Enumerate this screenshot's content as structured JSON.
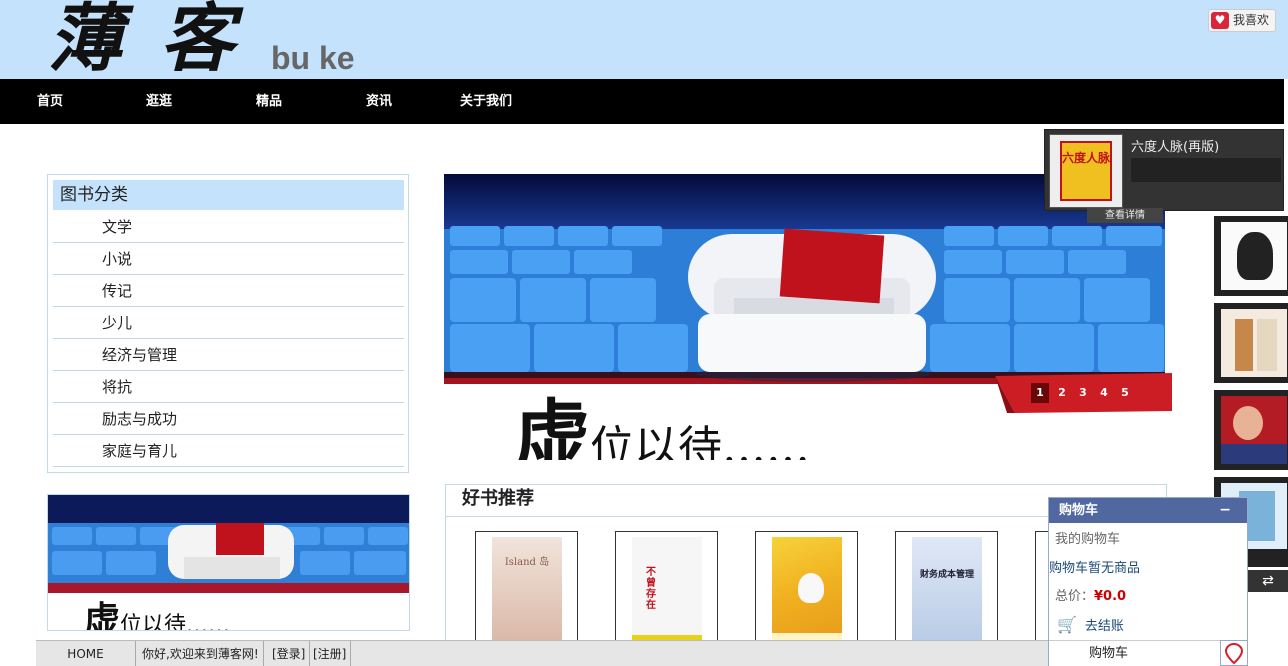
{
  "header": {
    "logo_cn": "薄客",
    "logo_en": "bu ke",
    "like_label": "我喜欢"
  },
  "nav": {
    "items": [
      "首页",
      "逛逛",
      "精品",
      "资讯",
      "关于我们"
    ]
  },
  "categories": {
    "title": "图书分类",
    "items": [
      "文学",
      "小说",
      "传记",
      "少儿",
      "经济与管理",
      "将抗",
      "励志与成功",
      "家庭与育儿"
    ]
  },
  "banner": {
    "slogan_big": "虚",
    "slogan_rest": "位以待……",
    "pages": [
      "1",
      "2",
      "3",
      "4",
      "5"
    ],
    "active_page": "1"
  },
  "ad_small": {
    "slogan_big": "虚",
    "slogan_rest": "位以待……"
  },
  "recommend": {
    "title": "好书推荐",
    "books": [
      {
        "cover_text": "Island 岛"
      },
      {
        "cover_text": "不曾存在"
      },
      {
        "cover_text": ""
      },
      {
        "cover_text": "财务成本管理"
      }
    ]
  },
  "detail": {
    "book_name": "六度人脉(再版)",
    "thumb_text": "六度人脉",
    "button_label": "查看详情"
  },
  "cart": {
    "title": "购物车",
    "minimize": "−",
    "my_cart": "我的购物车",
    "empty_text": "购物车暂无商品",
    "total_label": "总价：",
    "total_value": "¥0.0",
    "checkout": "去结账",
    "footer_label": "购物车"
  },
  "bottombar": {
    "home": "HOME",
    "welcome": "你好,欢迎来到薄客网!",
    "login": "[登录]",
    "register": "[注册]"
  },
  "colors": {
    "header_bg": "#c4e2fb",
    "nav_bg": "#000000",
    "cart_head": "#50679f",
    "price_red": "#cc0000"
  }
}
